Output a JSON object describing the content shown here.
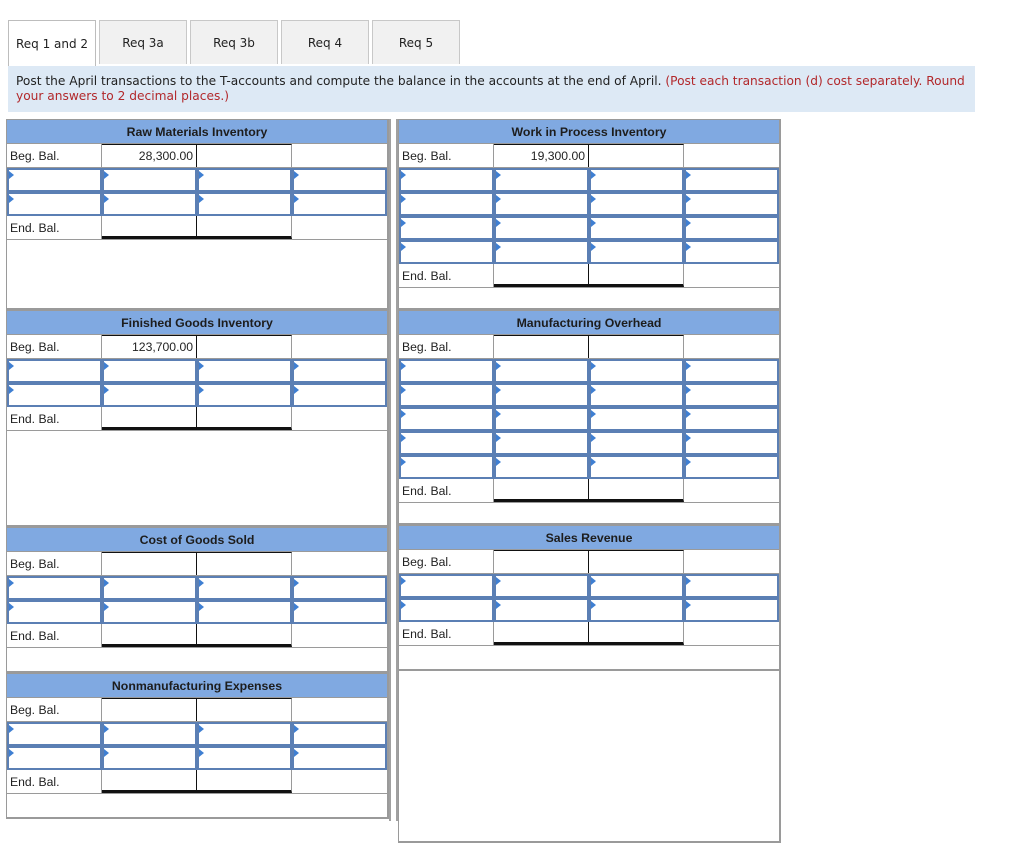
{
  "tabs": [
    {
      "label": "Req 1 and 2",
      "active": true
    },
    {
      "label": "Req 3a",
      "active": false
    },
    {
      "label": "Req 3b",
      "active": false
    },
    {
      "label": "Req 4",
      "active": false
    },
    {
      "label": "Req 5",
      "active": false
    }
  ],
  "instructions": {
    "main": "Post the April transactions to the T-accounts and compute the balance in the accounts at the end of April.",
    "note": "(Post each transaction (d) cost separately. Round your answers to 2 decimal places.)"
  },
  "labels": {
    "beg": "Beg. Bal.",
    "end": "End. Bal."
  },
  "accounts": {
    "raw_materials": {
      "title": "Raw Materials Inventory",
      "beg_debit": "28,300.00",
      "beg_credit": "",
      "input_rows": 2,
      "end_debit": "",
      "end_credit": ""
    },
    "work_in_process": {
      "title": "Work in Process Inventory",
      "beg_debit": "19,300.00",
      "beg_credit": "",
      "input_rows": 4,
      "end_debit": "",
      "end_credit": ""
    },
    "finished_goods": {
      "title": "Finished Goods Inventory",
      "beg_debit": "123,700.00",
      "beg_credit": "",
      "input_rows": 2,
      "end_debit": "",
      "end_credit": ""
    },
    "manufacturing_overhead": {
      "title": "Manufacturing Overhead",
      "beg_debit": "",
      "beg_credit": "",
      "input_rows": 5,
      "end_debit": "",
      "end_credit": ""
    },
    "cost_of_goods_sold": {
      "title": "Cost of Goods Sold",
      "beg_debit": "",
      "beg_credit": "",
      "input_rows": 2,
      "end_debit": "",
      "end_credit": ""
    },
    "sales_revenue": {
      "title": "Sales Revenue",
      "beg_debit": "",
      "beg_credit": "",
      "input_rows": 2,
      "end_debit": "",
      "end_credit": ""
    },
    "nonmanufacturing_expenses": {
      "title": "Nonmanufacturing Expenses",
      "beg_debit": "",
      "beg_credit": "",
      "input_rows": 2,
      "end_debit": "",
      "end_credit": ""
    }
  },
  "colors": {
    "header_bg": "#80a9e1",
    "instruction_bg": "#dde9f5",
    "note_red": "#b2282b",
    "input_border": "#5b7fb4"
  }
}
